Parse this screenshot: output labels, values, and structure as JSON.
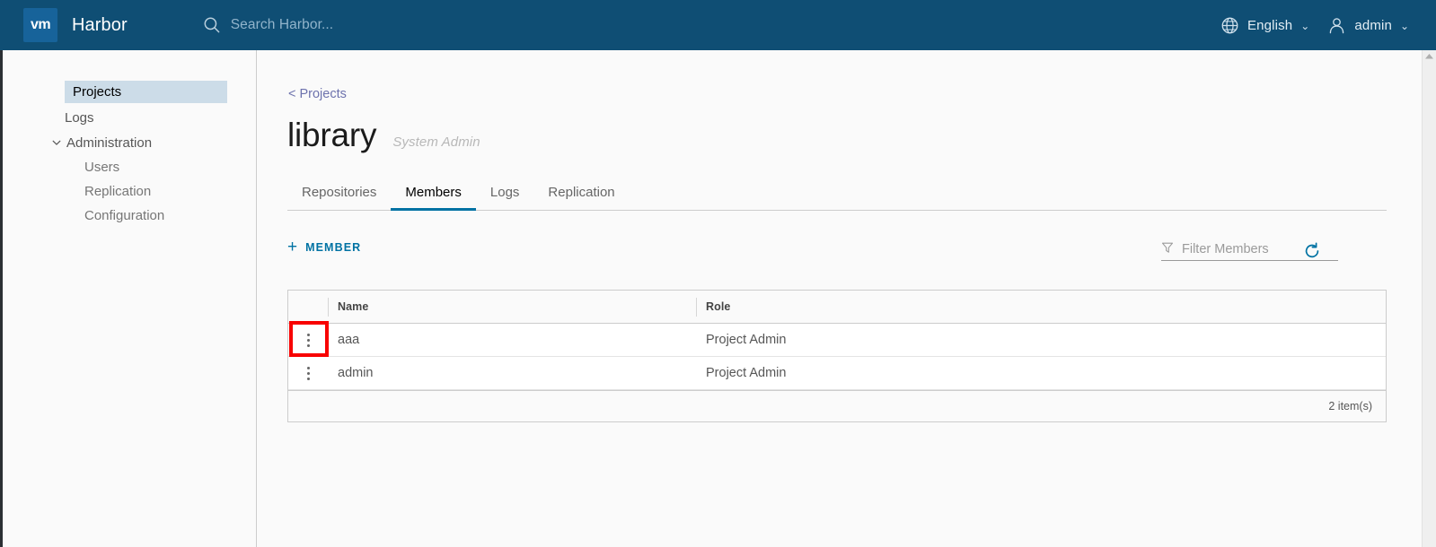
{
  "header": {
    "logo_text": "vm",
    "logo_icon": "vmware-logo-icon",
    "brand": "Harbor",
    "search_placeholder": "Search Harbor...",
    "search_icon": "search-icon",
    "language": {
      "icon": "globe-icon",
      "label": "English",
      "caret": "⌄"
    },
    "user": {
      "icon": "user-icon",
      "label": "admin",
      "caret": "⌄"
    },
    "colors": {
      "background": "#0f4e74",
      "logo_tile": "#17639a",
      "text": "#ffffff",
      "placeholder": "#91b4cb"
    }
  },
  "sidebar": {
    "items": [
      {
        "label": "Projects",
        "level": "top",
        "active": true
      },
      {
        "label": "Logs",
        "level": "top",
        "active": false
      }
    ],
    "group": {
      "label": "Administration",
      "expanded": true,
      "chevron_icon": "chevron-down-icon",
      "children": [
        {
          "label": "Users"
        },
        {
          "label": "Replication"
        },
        {
          "label": "Configuration"
        }
      ]
    },
    "active_background": "#ccdce8"
  },
  "main": {
    "breadcrumb": "< Projects",
    "project_title": "library",
    "project_badge": "System Admin",
    "tabs": [
      {
        "label": "Repositories",
        "active": false
      },
      {
        "label": "Members",
        "active": true
      },
      {
        "label": "Logs",
        "active": false
      },
      {
        "label": "Replication",
        "active": false
      }
    ],
    "tab_accent": "#0072a3",
    "actions": {
      "add_member_label": "MEMBER",
      "add_member_plus": "+",
      "add_member_color": "#0072a3",
      "filter_placeholder": "Filter Members",
      "filter_icon": "filter-funnel-icon",
      "refresh_icon": "refresh-icon",
      "refresh_color": "#0072a3"
    },
    "table": {
      "columns": [
        "",
        "Name",
        "Role"
      ],
      "rows": [
        {
          "kebab_icon": "kebab-menu-icon",
          "name": "aaa",
          "role": "Project Admin",
          "highlighted": true
        },
        {
          "kebab_icon": "kebab-menu-icon",
          "name": "admin",
          "role": "Project Admin",
          "highlighted": false
        }
      ],
      "footer_count": "2 item(s)"
    }
  },
  "annotation": {
    "color": "#f80000",
    "target": "kebab-menu-icon-row-aaa"
  },
  "scrollbar": {
    "up_arrow_icon": "scroll-up-arrow-icon",
    "track_color": "#efefef"
  }
}
